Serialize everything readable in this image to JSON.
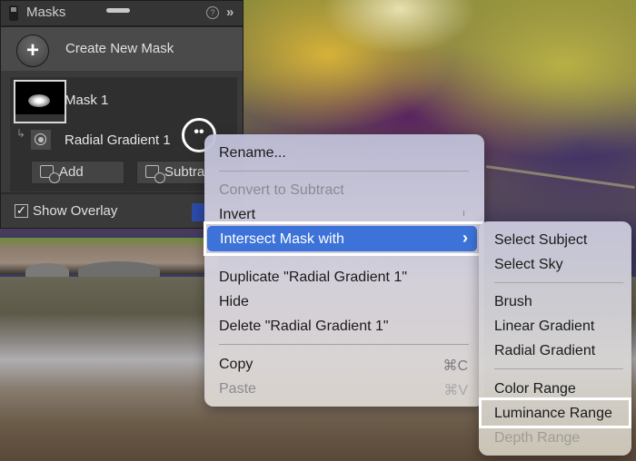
{
  "panel": {
    "title": "Masks",
    "help_icon": "?",
    "collapse_icon": "»",
    "create_label": "Create New Mask",
    "plus_icon": "+",
    "mask": {
      "name": "Mask 1"
    },
    "component": {
      "name": "Radial Gradient 1",
      "arrow_icon": "↳"
    },
    "more_icon": "••",
    "add_label": "Add",
    "subtract_label": "Subtra",
    "show_overlay": {
      "label": "Show Overlay",
      "checked": true,
      "check_glyph": "✓"
    },
    "overlay_color": "#2c4aa8"
  },
  "context_menu": {
    "items": [
      {
        "label": "Rename...",
        "disabled": false
      },
      {
        "label": "Convert to Subtract",
        "disabled": true
      },
      {
        "label": "Invert",
        "disabled": false
      },
      {
        "label": "Intersect Mask with",
        "highlighted": true,
        "submenu_icon": "›"
      },
      {
        "label": "Duplicate \"Radial Gradient 1\"",
        "disabled": false
      },
      {
        "label": "Hide",
        "disabled": false
      },
      {
        "label": "Delete \"Radial Gradient 1\"",
        "disabled": false
      },
      {
        "label": "Copy",
        "shortcut": "⌘C",
        "disabled": false
      },
      {
        "label": "Paste",
        "shortcut": "⌘V",
        "disabled": true
      }
    ],
    "highlight_color": "#3d73d8"
  },
  "submenu": {
    "items": [
      {
        "label": "Select Subject"
      },
      {
        "label": "Select Sky"
      },
      {
        "label": "Brush"
      },
      {
        "label": "Linear Gradient"
      },
      {
        "label": "Radial Gradient"
      },
      {
        "label": "Color Range"
      },
      {
        "label": "Luminance Range",
        "selected": true
      },
      {
        "label": "Depth Range",
        "disabled": true
      }
    ]
  }
}
